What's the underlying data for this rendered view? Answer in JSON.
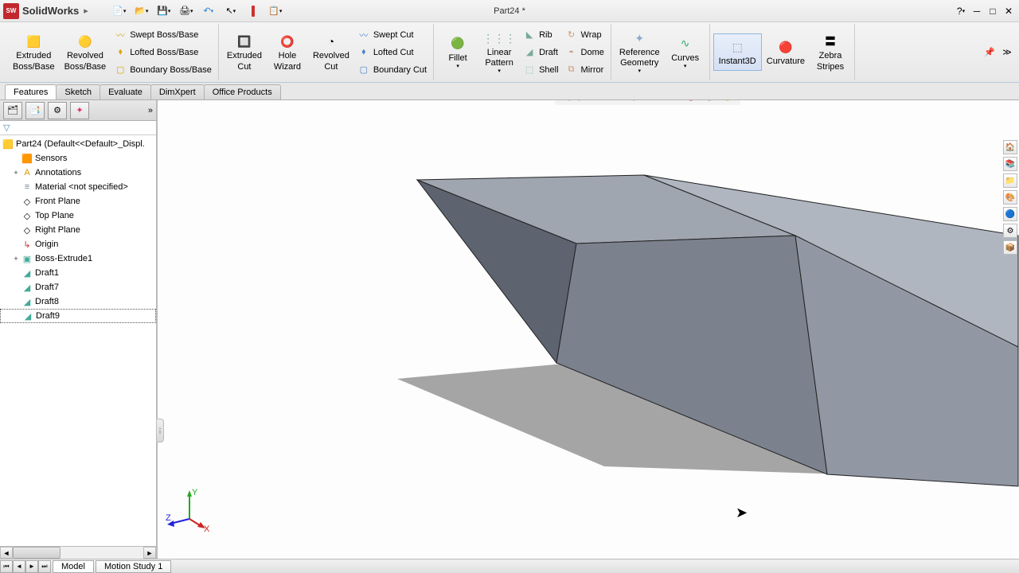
{
  "app": {
    "name": "SolidWorks",
    "logo_text": "SW"
  },
  "doc_title": "Part24 *",
  "quick_tools": [
    "new",
    "open",
    "save",
    "print",
    "undo",
    "select",
    "stop",
    "view"
  ],
  "ribbon": {
    "extruded_boss": "Extruded\nBoss/Base",
    "revolved_boss": "Revolved\nBoss/Base",
    "swept_boss": "Swept Boss/Base",
    "lofted_boss": "Lofted Boss/Base",
    "boundary_boss": "Boundary Boss/Base",
    "extruded_cut": "Extruded\nCut",
    "hole_wizard": "Hole\nWizard",
    "revolved_cut": "Revolved\nCut",
    "swept_cut": "Swept Cut",
    "lofted_cut": "Lofted Cut",
    "boundary_cut": "Boundary Cut",
    "fillet": "Fillet",
    "linear_pattern": "Linear\nPattern",
    "rib": "Rib",
    "draft": "Draft",
    "shell": "Shell",
    "wrap": "Wrap",
    "dome": "Dome",
    "mirror": "Mirror",
    "ref_geom": "Reference\nGeometry",
    "curves": "Curves",
    "instant3d": "Instant3D",
    "curvature": "Curvature",
    "zebra": "Zebra\nStripes"
  },
  "tabs": [
    "Features",
    "Sketch",
    "Evaluate",
    "DimXpert",
    "Office Products"
  ],
  "tree": {
    "root": "Part24  (Default<<Default>_Displ.",
    "items": [
      "Sensors",
      "Annotations",
      "Material <not specified>",
      "Front Plane",
      "Top Plane",
      "Right Plane",
      "Origin",
      "Boss-Extrude1",
      "Draft1",
      "Draft7",
      "Draft8",
      "Draft9"
    ]
  },
  "status_tabs": [
    "Model",
    "Motion Study 1"
  ],
  "triad": {
    "x": "X",
    "y": "Y",
    "z": "Z"
  }
}
